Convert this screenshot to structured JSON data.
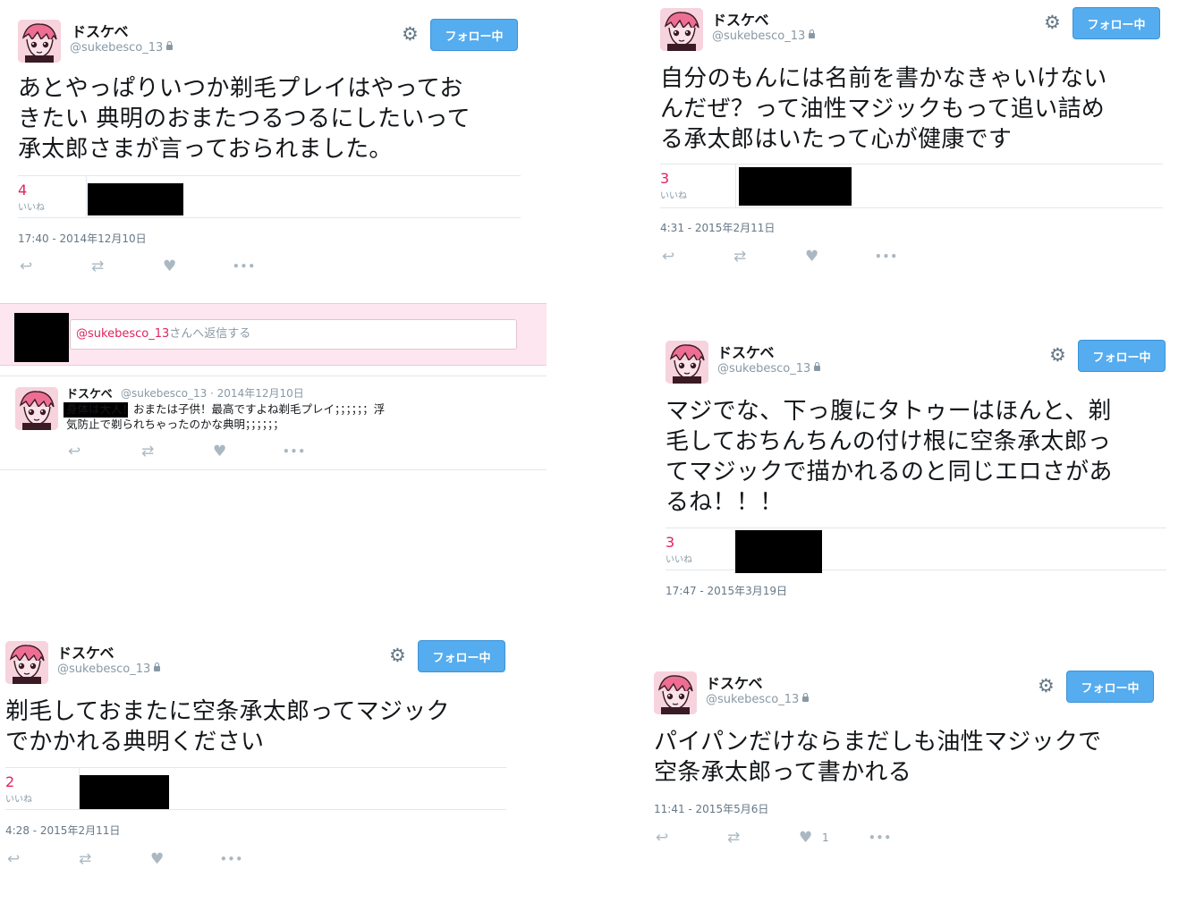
{
  "common": {
    "display_name": "ドスケベ",
    "handle": "@sukebesco_13",
    "follow_label": "フォロー中",
    "likes_label": "いいね",
    "more_glyph": "•••"
  },
  "tweets": [
    {
      "text": "あとやっぱりいつか剃毛プレイはやってお\nきたい 典明のおまたつるつるにしたいって\n承太郎さまが言っておられました。",
      "likes": "4",
      "timestamp": "17:40 - 2014年12月10日"
    },
    {
      "text": "自分のもんには名前を書かなきゃいけない\nんだぜ？って油性マジックもって追い詰め\nる承太郎はいたって心が健康です",
      "likes": "3",
      "timestamp": "4:31 - 2015年2月11日"
    },
    {
      "text": "マジでな、下っ腹にタトゥーはほんと、剃\n毛しておちんちんの付け根に空条承太郎っ\nてマジックで描かれるのと同じエロさがあ\nるね！！！",
      "likes": "3",
      "timestamp": "17:47 - 2015年3月19日"
    },
    {
      "text": "剃毛しておまたに空条承太郎ってマジック\nでかかれる典明ください",
      "likes": "2",
      "timestamp": "4:28 - 2015年2月11日"
    },
    {
      "text": "パイパンだけならまだしも油性マジックで\n空条承太郎って書かれる",
      "timestamp": "11:41 - 2015年5月6日",
      "like_count": "1"
    }
  ],
  "reply": {
    "mention": "@sukebesco_13",
    "placeholder_suffix": "さんへ返信する",
    "sub_tweet": {
      "name": "ドスケベ",
      "meta": "@sukebesco_13 · 2014年12月10日",
      "text": "身体は大人！おまたは子供！最高ですよね剃毛プレイ；；；；；；浮\n気防止で剃られちゃったのかな典明；；；；；；"
    }
  },
  "icons": [
    "reply-icon",
    "retweet-icon",
    "heart-icon",
    "more-icon",
    "gear-icon",
    "lock-icon"
  ],
  "colors": {
    "follow": "#55acee",
    "likes": "#e0245e",
    "reply_band": "#fde6ef"
  }
}
